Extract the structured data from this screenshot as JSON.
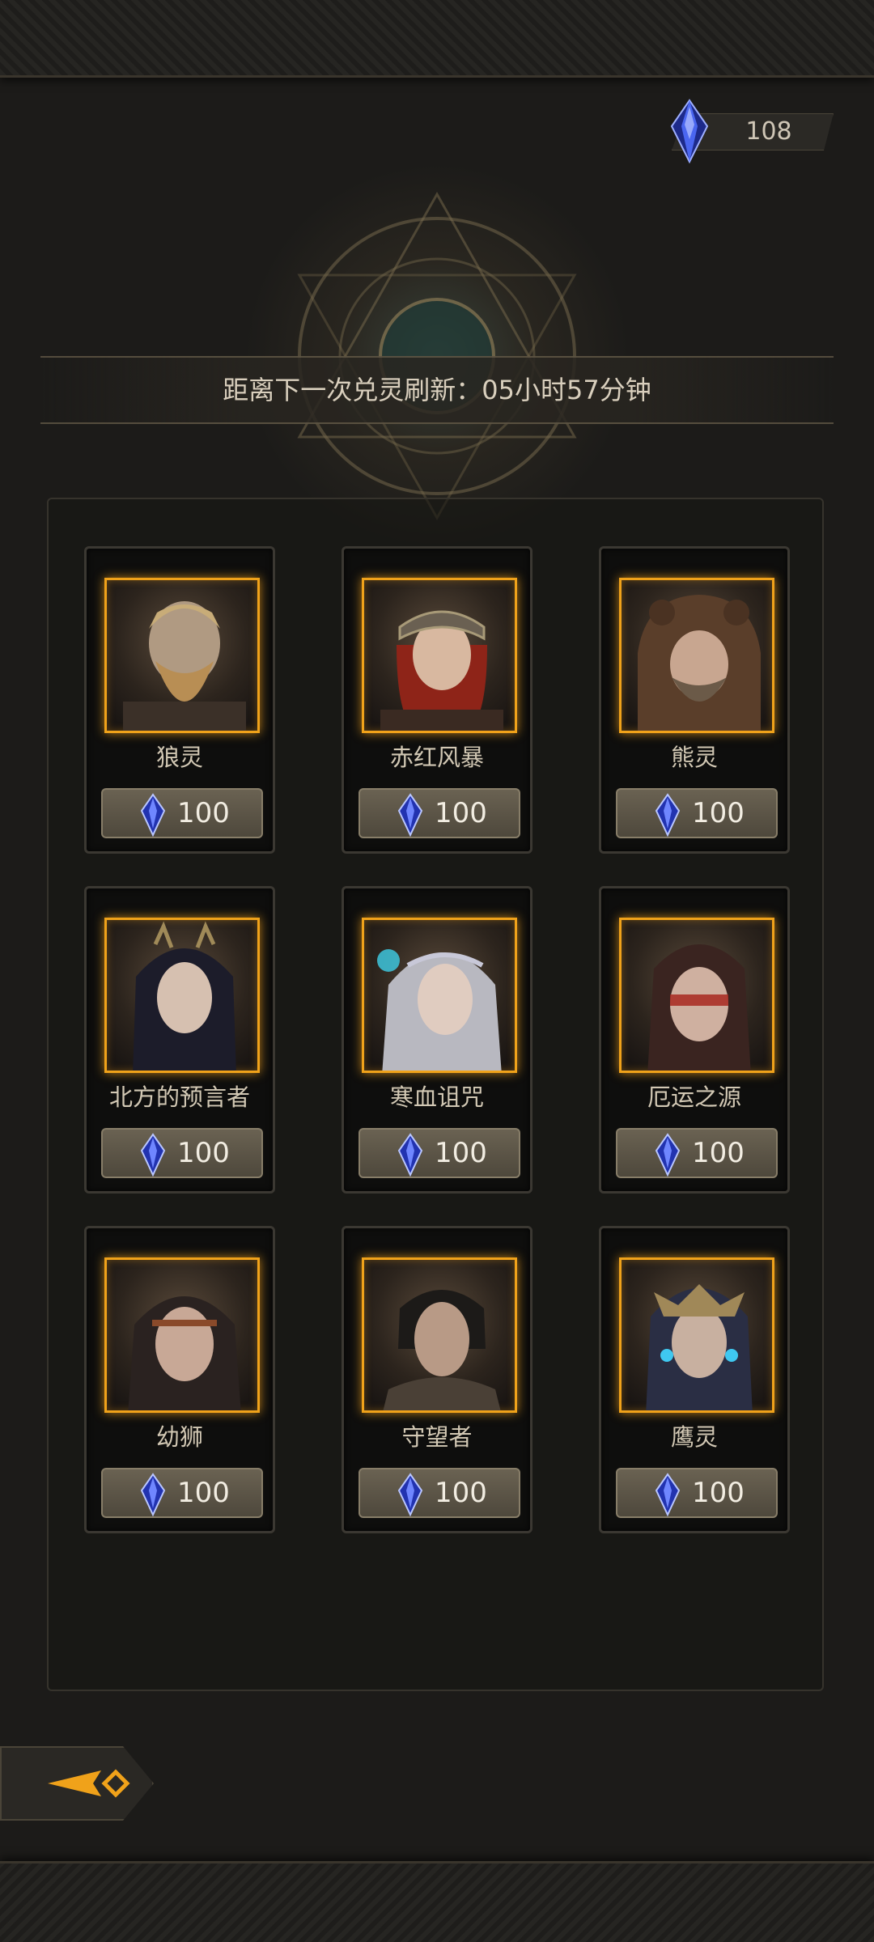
{
  "currency": {
    "icon": "blue-crystal-icon",
    "amount": "108"
  },
  "refresh": {
    "text": "距离下一次兑灵刷新：05小时57分钟"
  },
  "cards": [
    {
      "name": "狼灵",
      "price": "100",
      "portrait": "wolf-spirit-portrait"
    },
    {
      "name": "赤红风暴",
      "price": "100",
      "portrait": "crimson-storm-portrait"
    },
    {
      "name": "熊灵",
      "price": "100",
      "portrait": "bear-spirit-portrait"
    },
    {
      "name": "北方的预言者",
      "price": "100",
      "portrait": "northern-prophet-portrait"
    },
    {
      "name": "寒血诅咒",
      "price": "100",
      "portrait": "cold-blood-curse-portrait"
    },
    {
      "name": "厄运之源",
      "price": "100",
      "portrait": "source-of-doom-portrait"
    },
    {
      "name": "幼狮",
      "price": "100",
      "portrait": "young-lion-portrait"
    },
    {
      "name": "守望者",
      "price": "100",
      "portrait": "watcher-portrait"
    },
    {
      "name": "鹰灵",
      "price": "100",
      "portrait": "eagle-spirit-portrait"
    }
  ],
  "nav": {
    "back_icon": "back-arrow-icon"
  },
  "colors": {
    "accent": "#f0a21a",
    "crystal": "#3a4fd8",
    "panel": "#1c1b19"
  }
}
